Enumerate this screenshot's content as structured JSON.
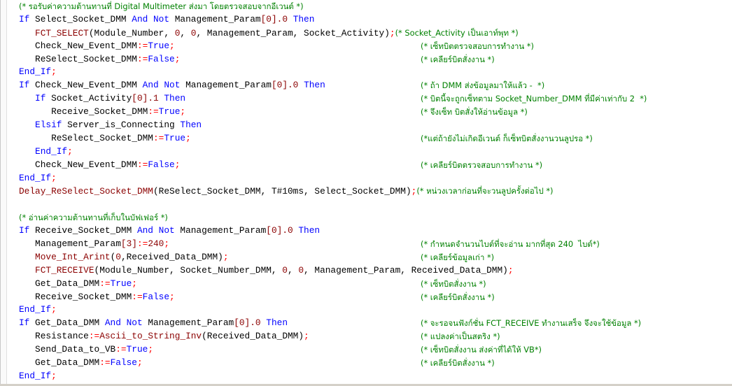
{
  "editor": {
    "lines": [
      {
        "segments": [
          {
            "t": "(* รอรับค่าความต้านทานที่ Digital Multimeter ส่งมา โดยตรวจสอบจากอีเวนต์ *)",
            "c": "cm"
          }
        ]
      },
      {
        "segments": [
          {
            "t": "If",
            "c": "kw"
          },
          {
            "t": " Select_Socket_DMM ",
            "c": "pu"
          },
          {
            "t": "And Not",
            "c": "kw"
          },
          {
            "t": " Management_Param",
            "c": "pu"
          },
          {
            "t": "[0].0",
            "c": "num"
          },
          {
            "t": " ",
            "c": "pu"
          },
          {
            "t": "Then",
            "c": "kw"
          }
        ]
      },
      {
        "segments": [
          {
            "t": "   FCT_SELECT",
            "c": "fn"
          },
          {
            "t": "(Module_Number, ",
            "c": "pu"
          },
          {
            "t": "0",
            "c": "num"
          },
          {
            "t": ", ",
            "c": "pu"
          },
          {
            "t": "0",
            "c": "num"
          },
          {
            "t": ", Management_Param, Socket_Activity)",
            "c": "pu"
          },
          {
            "t": ";",
            "c": "op"
          },
          {
            "t": "(* Socket_Activity เป็นเอาท์พุท *)",
            "c": "cm"
          }
        ]
      },
      {
        "segments": [
          {
            "t": "   Check_New_Event_DMM",
            "c": "pu"
          },
          {
            "t": ":=",
            "c": "op"
          },
          {
            "t": "True",
            "c": "kw"
          },
          {
            "t": ";",
            "c": "op"
          }
        ],
        "comment": "(* เซ็ทบิตตรวจสอบการทำงาน *)"
      },
      {
        "segments": [
          {
            "t": "   ReSelect_Socket_DMM",
            "c": "pu"
          },
          {
            "t": ":=",
            "c": "op"
          },
          {
            "t": "False",
            "c": "kw"
          },
          {
            "t": ";",
            "c": "op"
          }
        ],
        "comment": "(* เคลียร์บิตสั่งงาน *)"
      },
      {
        "segments": [
          {
            "t": "End_If",
            "c": "kw"
          },
          {
            "t": ";",
            "c": "op"
          }
        ]
      },
      {
        "segments": [
          {
            "t": "If",
            "c": "kw"
          },
          {
            "t": " Check_New_Event_DMM ",
            "c": "pu"
          },
          {
            "t": "And Not",
            "c": "kw"
          },
          {
            "t": " Management_Param",
            "c": "pu"
          },
          {
            "t": "[0].0",
            "c": "num"
          },
          {
            "t": " ",
            "c": "pu"
          },
          {
            "t": "Then",
            "c": "kw"
          }
        ],
        "comment": "(* ถ้า DMM ส่งข้อมูลมาให้แล้ว -  *)"
      },
      {
        "segments": [
          {
            "t": "   If",
            "c": "kw"
          },
          {
            "t": " Socket_Activity",
            "c": "pu"
          },
          {
            "t": "[0].1",
            "c": "num"
          },
          {
            "t": " ",
            "c": "pu"
          },
          {
            "t": "Then",
            "c": "kw"
          }
        ],
        "comment": "(* บิตนี้จะถูกเซ็ทตาม Socket_Number_DMM ที่มีค่าเท่ากับ 2  *)"
      },
      {
        "segments": [
          {
            "t": "      Receive_Socket_DMM",
            "c": "pu"
          },
          {
            "t": ":=",
            "c": "op"
          },
          {
            "t": "True",
            "c": "kw"
          },
          {
            "t": ";",
            "c": "op"
          }
        ],
        "comment": "(* จึงเซ็ท บิตสั่งให้อ่านข้อมูล *)"
      },
      {
        "segments": [
          {
            "t": "   Elsif",
            "c": "kw"
          },
          {
            "t": " Server_is_Connecting ",
            "c": "pu"
          },
          {
            "t": "Then",
            "c": "kw"
          }
        ]
      },
      {
        "segments": [
          {
            "t": "      ReSelect_Socket_DMM",
            "c": "pu"
          },
          {
            "t": ":=",
            "c": "op"
          },
          {
            "t": "True",
            "c": "kw"
          },
          {
            "t": ";",
            "c": "op"
          }
        ],
        "comment": "(*แต่ถ้ายังไม่เกิดอีเวนต์ ก็เซ็ทบิตสั่งงานวนลูปรอ *)"
      },
      {
        "segments": [
          {
            "t": "   End_If",
            "c": "kw"
          },
          {
            "t": ";",
            "c": "op"
          }
        ]
      },
      {
        "segments": [
          {
            "t": "   Check_New_Event_DMM",
            "c": "pu"
          },
          {
            "t": ":=",
            "c": "op"
          },
          {
            "t": "False",
            "c": "kw"
          },
          {
            "t": ";",
            "c": "op"
          }
        ],
        "comment": "(* เคลียร์บิตตรวจสอบการทำงาน *)"
      },
      {
        "segments": [
          {
            "t": "End_If",
            "c": "kw"
          },
          {
            "t": ";",
            "c": "op"
          }
        ]
      },
      {
        "segments": [
          {
            "t": "Delay_ReSelect_Socket_DMM",
            "c": "fn"
          },
          {
            "t": "(ReSelect_Socket_DMM, ",
            "c": "pu"
          },
          {
            "t": "T#10ms",
            "c": "pu"
          },
          {
            "t": ", Select_Socket_DMM)",
            "c": "pu"
          },
          {
            "t": ";",
            "c": "op"
          },
          {
            "t": "(* หน่วงเวลาก่อนที่จะวนลูปครั้งต่อไป *)",
            "c": "cm"
          }
        ]
      },
      {
        "segments": [
          {
            "t": "",
            "c": "pu"
          }
        ]
      },
      {
        "segments": [
          {
            "t": "(* อ่านค่าความต้านทานที่เก็บในบัฟเฟอร์ *)",
            "c": "cm"
          }
        ]
      },
      {
        "segments": [
          {
            "t": "If",
            "c": "kw"
          },
          {
            "t": " Receive_Socket_DMM ",
            "c": "pu"
          },
          {
            "t": "And Not",
            "c": "kw"
          },
          {
            "t": " Management_Param",
            "c": "pu"
          },
          {
            "t": "[0].0",
            "c": "num"
          },
          {
            "t": " ",
            "c": "pu"
          },
          {
            "t": "Then",
            "c": "kw"
          }
        ]
      },
      {
        "segments": [
          {
            "t": "   Management_Param",
            "c": "pu"
          },
          {
            "t": "[3]",
            "c": "num"
          },
          {
            "t": ":=",
            "c": "op"
          },
          {
            "t": "240",
            "c": "num"
          },
          {
            "t": ";",
            "c": "op"
          }
        ],
        "comment": "(* กำหนดจำนวนไบต์ที่จะอ่าน มากที่สุด 240  ไบต์*)"
      },
      {
        "segments": [
          {
            "t": "   Move_Int_Arint",
            "c": "fn"
          },
          {
            "t": "(",
            "c": "pu"
          },
          {
            "t": "0",
            "c": "num"
          },
          {
            "t": ",Received_Data_DMM)",
            "c": "pu"
          },
          {
            "t": ";",
            "c": "op"
          }
        ],
        "comment": "(* เคลียร์ข้อมูลเก่า *)"
      },
      {
        "segments": [
          {
            "t": "   FCT_RECEIVE",
            "c": "fn"
          },
          {
            "t": "(Module_Number, Socket_Number_DMM, ",
            "c": "pu"
          },
          {
            "t": "0",
            "c": "num"
          },
          {
            "t": ", ",
            "c": "pu"
          },
          {
            "t": "0",
            "c": "num"
          },
          {
            "t": ", Management_Param, Received_Data_DMM)",
            "c": "pu"
          },
          {
            "t": ";",
            "c": "op"
          }
        ]
      },
      {
        "segments": [
          {
            "t": "   Get_Data_DMM",
            "c": "pu"
          },
          {
            "t": ":=",
            "c": "op"
          },
          {
            "t": "True",
            "c": "kw"
          },
          {
            "t": ";",
            "c": "op"
          }
        ],
        "comment": "(* เซ็ทบิตสั่งงาน *)"
      },
      {
        "segments": [
          {
            "t": "   Receive_Socket_DMM",
            "c": "pu"
          },
          {
            "t": ":=",
            "c": "op"
          },
          {
            "t": "False",
            "c": "kw"
          },
          {
            "t": ";",
            "c": "op"
          }
        ],
        "comment": "(* เคลียร์บิตสั่งงาน *)"
      },
      {
        "segments": [
          {
            "t": "End_If",
            "c": "kw"
          },
          {
            "t": ";",
            "c": "op"
          }
        ]
      },
      {
        "segments": [
          {
            "t": "If",
            "c": "kw"
          },
          {
            "t": " Get_Data_DMM ",
            "c": "pu"
          },
          {
            "t": "And Not",
            "c": "kw"
          },
          {
            "t": " Management_Param",
            "c": "pu"
          },
          {
            "t": "[0].0",
            "c": "num"
          },
          {
            "t": " ",
            "c": "pu"
          },
          {
            "t": "Then",
            "c": "kw"
          }
        ],
        "comment": "(* จะรอจนฟังก์ชั่น FCT_RECEIVE ทำงานเสร็จ จึงจะใช้ข้อมูล *)"
      },
      {
        "segments": [
          {
            "t": "   Resistance",
            "c": "pu"
          },
          {
            "t": ":=",
            "c": "op"
          },
          {
            "t": "Ascii_to_String_Inv",
            "c": "fn"
          },
          {
            "t": "(Received_Data_DMM)",
            "c": "pu"
          },
          {
            "t": ";",
            "c": "op"
          }
        ],
        "comment": "(* แปลงค่าเป็นสตริง *)"
      },
      {
        "segments": [
          {
            "t": "   Send_Data_to_VB",
            "c": "pu"
          },
          {
            "t": ":=",
            "c": "op"
          },
          {
            "t": "True",
            "c": "kw"
          },
          {
            "t": ";",
            "c": "op"
          }
        ],
        "comment": "(* เซ็ทบิตสั่งงาน ส่งค่าที่ได้ให้ VB*)"
      },
      {
        "segments": [
          {
            "t": "   Get_Data_DMM",
            "c": "pu"
          },
          {
            "t": ":=",
            "c": "op"
          },
          {
            "t": "False",
            "c": "kw"
          },
          {
            "t": ";",
            "c": "op"
          }
        ],
        "comment": "(* เคลียร์บิตสั่งงาน *)"
      },
      {
        "segments": [
          {
            "t": "End_If",
            "c": "kw"
          },
          {
            "t": ";",
            "c": "op"
          }
        ]
      }
    ]
  }
}
